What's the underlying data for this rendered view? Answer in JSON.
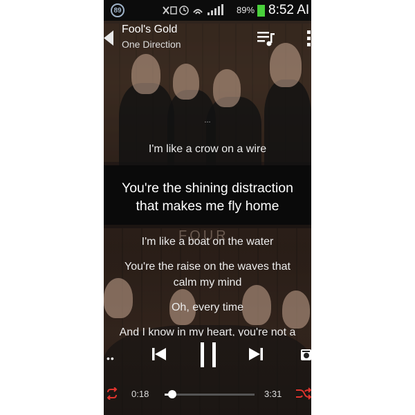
{
  "status_bar": {
    "notification_count": "89",
    "battery_percent": "89%",
    "time": "8:52 AI",
    "battery_color": "#49d13b"
  },
  "header": {
    "title": "Fool's Gold",
    "artist": "One Direction"
  },
  "lyrics": {
    "line_prev": "I'm like a crow on a wire",
    "current_line_1": "You're the shining distraction",
    "current_line_2": "that makes me fly home",
    "line_next_1": "I'm like a boat on the water",
    "line_next_2a": "You're the raise on the waves that",
    "line_next_2b": "calm my mind",
    "line_next_3": "Oh, every time",
    "line_next_4": "And I know in my heart, you're not a"
  },
  "album_watermark": "FOUR",
  "player": {
    "elapsed": "0:18",
    "total": "3:31",
    "progress_fraction": 0.085,
    "accent_color": "#e0342e"
  },
  "icons": {
    "back": "back-arrow-icon",
    "queue": "queue-music-icon",
    "overflow": "overflow-menu-icon",
    "prev": "skip-previous-icon",
    "pause": "pause-icon",
    "next": "skip-next-icon",
    "repeat": "repeat-icon",
    "shuffle": "shuffle-icon",
    "cast": "cast-icon"
  }
}
